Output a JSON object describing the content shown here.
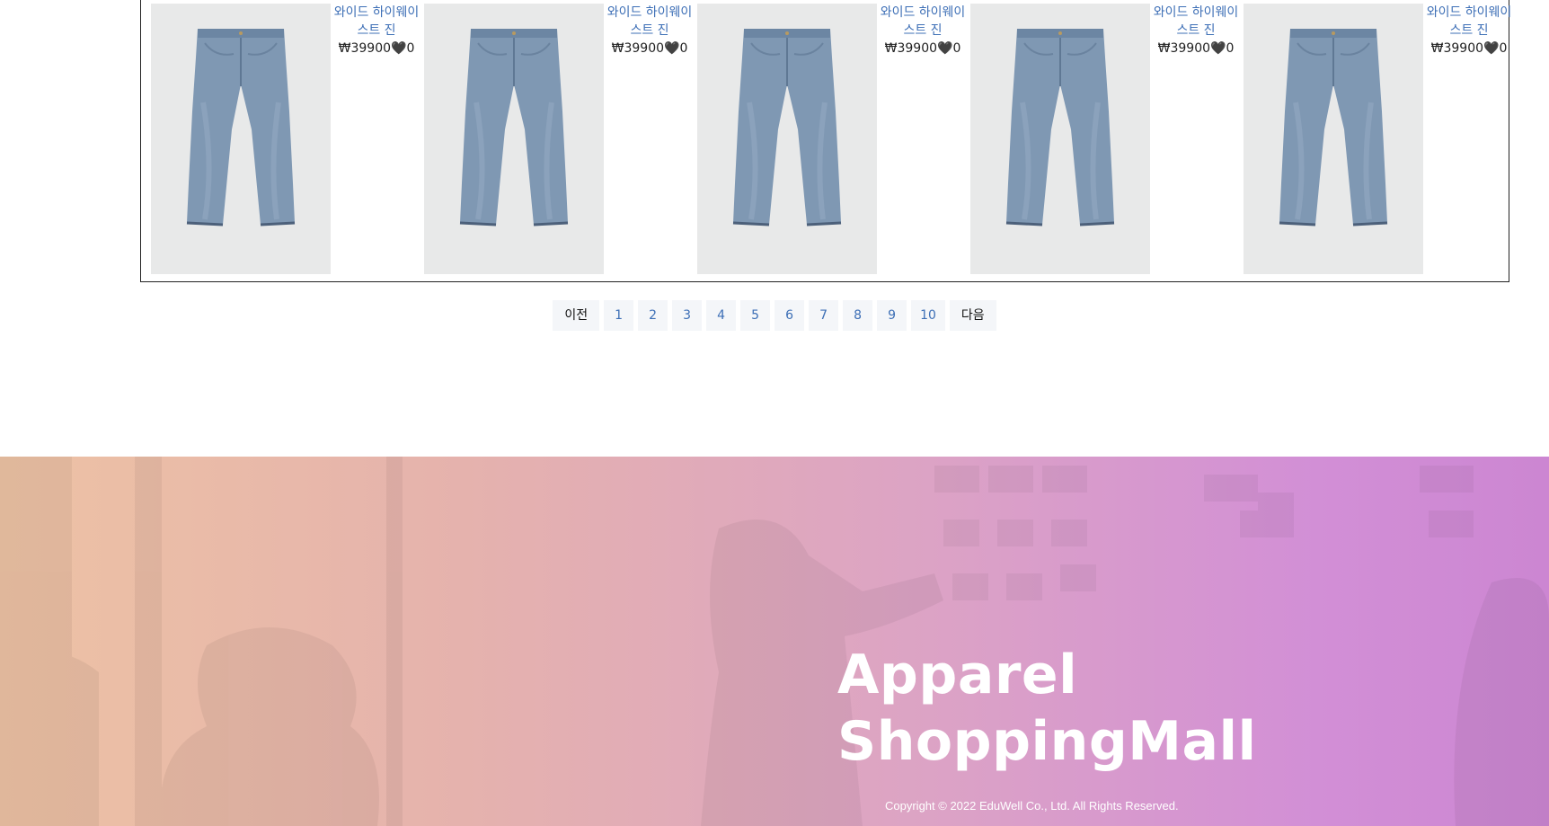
{
  "products": [
    {
      "name": "와이드 하이웨이스트 진",
      "price_line": "₩39900🖤0"
    },
    {
      "name": "와이드 하이웨이스트 진",
      "price_line": "₩39900🖤0"
    },
    {
      "name": "와이드 하이웨이스트 진",
      "price_line": "₩39900🖤0"
    },
    {
      "name": "와이드 하이웨이스트 진",
      "price_line": "₩39900🖤0"
    },
    {
      "name": "와이드 하이웨이스트 진",
      "price_line": "₩39900🖤0"
    }
  ],
  "pagination": {
    "prev": "이전",
    "pages": [
      "1",
      "2",
      "3",
      "4",
      "5",
      "6",
      "7",
      "8",
      "9",
      "10"
    ],
    "next": "다음"
  },
  "footer": {
    "brand_line1": "Apparel",
    "brand_line2": "ShoppingMall",
    "copyright": "Copyright © 2022 EduWell Co., Ltd. All Rights Reserved."
  },
  "colors": {
    "link": "#3d6fb6",
    "pagination_bg": "#f4f6f9",
    "footer_gradient_start": "#edc2a4",
    "footer_gradient_end": "#cc86d2"
  }
}
